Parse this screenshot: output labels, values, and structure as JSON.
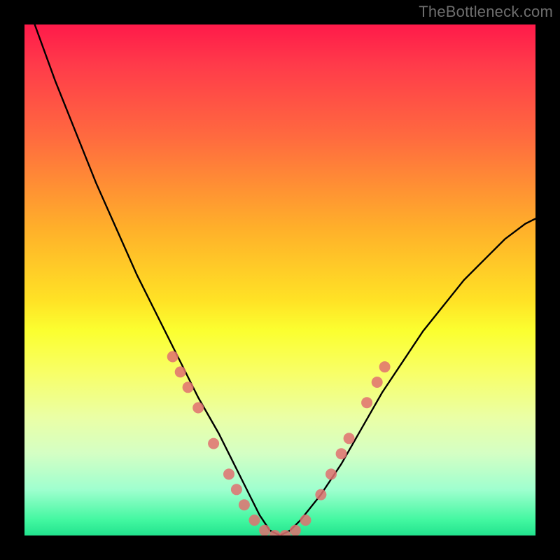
{
  "branding": {
    "watermark": "TheBottleneck.com"
  },
  "chart_data": {
    "type": "line",
    "title": "",
    "xlabel": "",
    "ylabel": "",
    "xlim": [
      0,
      100
    ],
    "ylim": [
      0,
      100
    ],
    "grid": false,
    "legend": "none",
    "series": [
      {
        "name": "bottleneck-curve",
        "x": [
          2,
          6,
          10,
          14,
          18,
          22,
          26,
          30,
          34,
          38,
          40,
          42,
          44,
          46,
          48,
          50,
          52,
          54,
          58,
          62,
          66,
          70,
          74,
          78,
          82,
          86,
          90,
          94,
          98,
          100
        ],
        "y": [
          100,
          89,
          79,
          69,
          60,
          51,
          43,
          35,
          27,
          20,
          16,
          12,
          8,
          4,
          1,
          0,
          1,
          3,
          8,
          14,
          21,
          28,
          34,
          40,
          45,
          50,
          54,
          58,
          61,
          62
        ]
      }
    ],
    "markers": {
      "name": "highlight-points",
      "color": "#e07070",
      "points": [
        {
          "x": 29,
          "y": 35
        },
        {
          "x": 30.5,
          "y": 32
        },
        {
          "x": 32,
          "y": 29
        },
        {
          "x": 34,
          "y": 25
        },
        {
          "x": 37,
          "y": 18
        },
        {
          "x": 40,
          "y": 12
        },
        {
          "x": 41.5,
          "y": 9
        },
        {
          "x": 43,
          "y": 6
        },
        {
          "x": 45,
          "y": 3
        },
        {
          "x": 47,
          "y": 1
        },
        {
          "x": 49,
          "y": 0
        },
        {
          "x": 51,
          "y": 0
        },
        {
          "x": 53,
          "y": 1
        },
        {
          "x": 55,
          "y": 3
        },
        {
          "x": 58,
          "y": 8
        },
        {
          "x": 60,
          "y": 12
        },
        {
          "x": 62,
          "y": 16
        },
        {
          "x": 63.5,
          "y": 19
        },
        {
          "x": 67,
          "y": 26
        },
        {
          "x": 69,
          "y": 30
        },
        {
          "x": 70.5,
          "y": 33
        }
      ]
    },
    "gradient_stops": [
      {
        "pos": 0,
        "color": "#ff1a4a"
      },
      {
        "pos": 22,
        "color": "#ff6a3f"
      },
      {
        "pos": 54,
        "color": "#ffe225"
      },
      {
        "pos": 77,
        "color": "#eaffa6"
      },
      {
        "pos": 100,
        "color": "#22e38e"
      }
    ]
  }
}
